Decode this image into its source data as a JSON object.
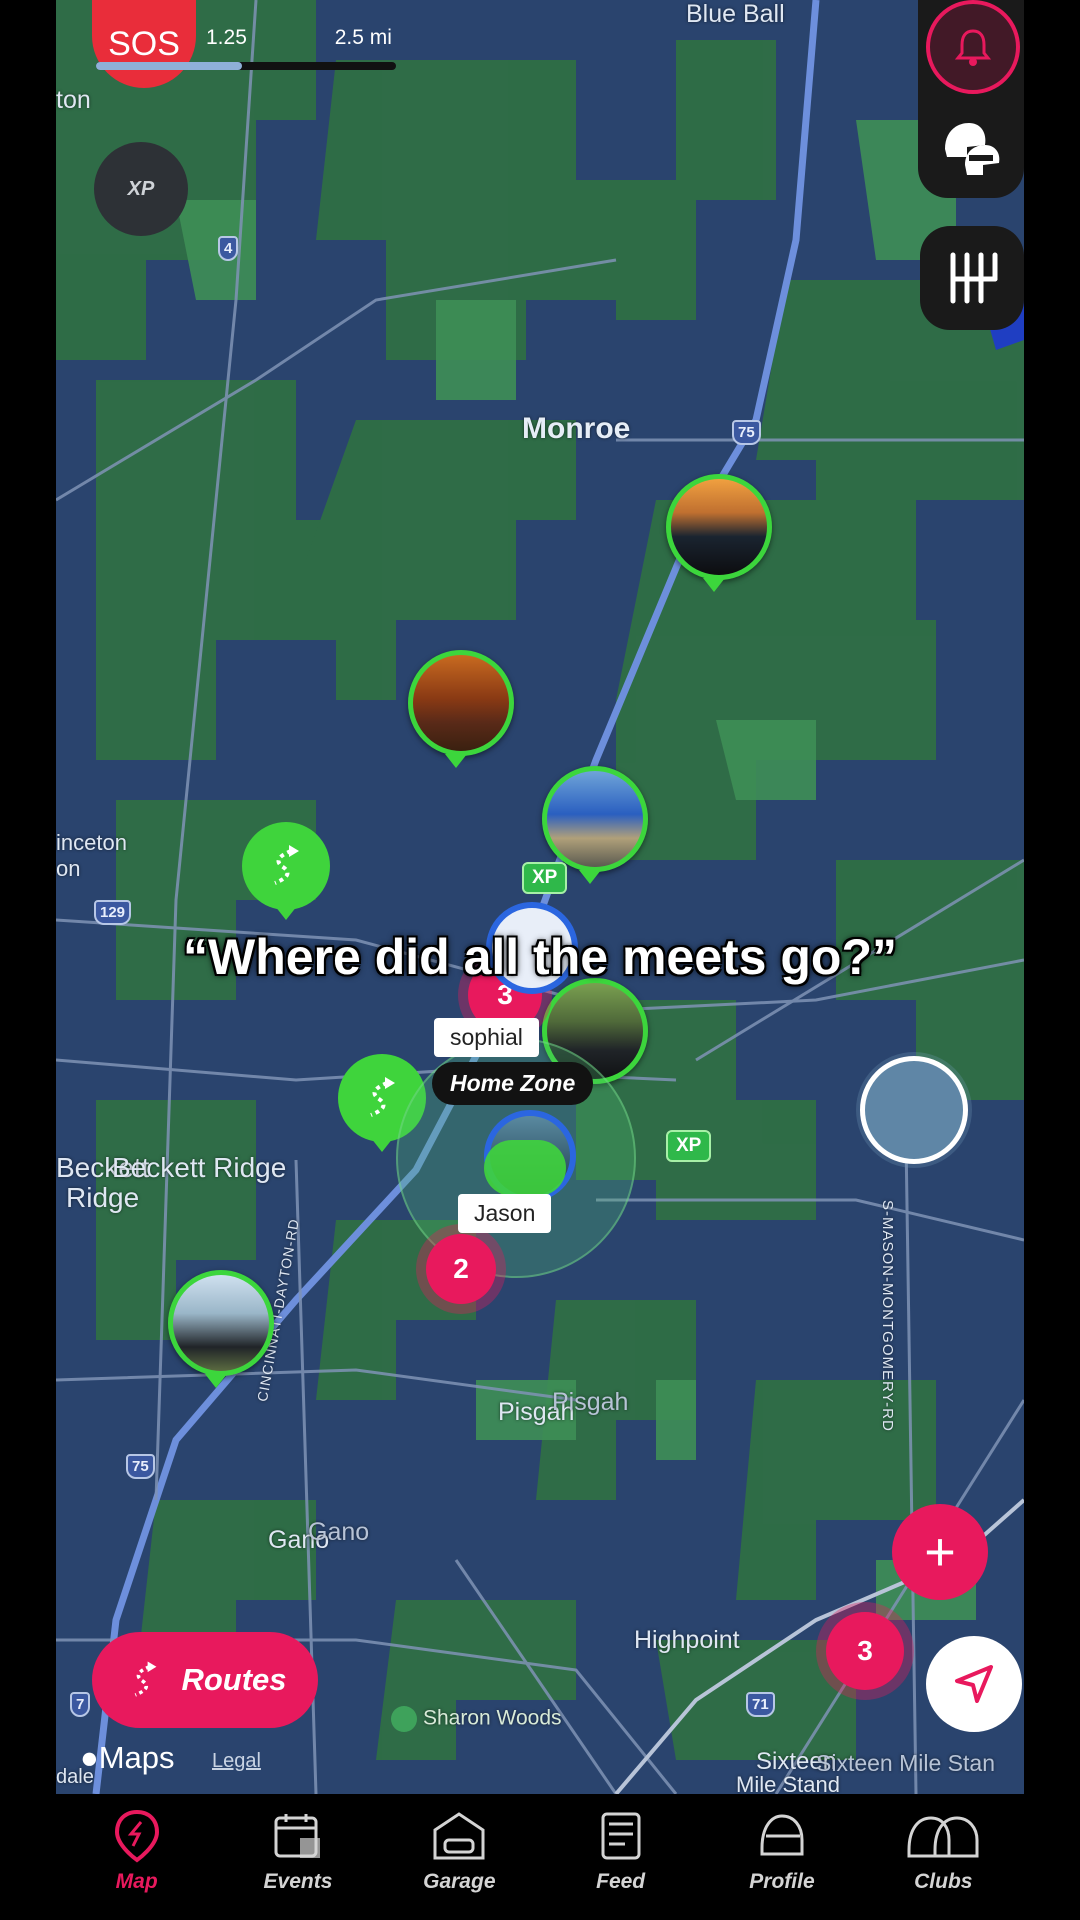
{
  "colors": {
    "accent": "#e8195d",
    "pin_green": "#3cd63c",
    "map_water": "#2a446e",
    "map_land": "#2f6d45"
  },
  "header": {
    "sos_label": "SOS",
    "scale_mid": "1.25",
    "scale_end": "2.5 mi",
    "xp_badge": "XP"
  },
  "map": {
    "labels": {
      "blue_ball": "Blue Ball",
      "ton": "ton",
      "monroe": "Monroe",
      "inceton": "inceton",
      "on": "on",
      "beckett1": "Beckett",
      "beckett_ridge": "Beckett Ridge",
      "ridge": "Ridge",
      "pisgah1": "Pisgah",
      "pisgah2": "Pisgah",
      "gano1": "Gano",
      "gano2": "Gano",
      "highpoint": "Highpoint",
      "sharon_woods": "Sharon Woods",
      "sixteen1": "Sixteen",
      "sixteen2": "Mile Stand",
      "sixteen3": "Sixteen Mile Stan",
      "dale": "dale",
      "mason_rd": "S-MASON-MONTGOMERY-RD",
      "cin_day": "CINCINNATI-DAYTON-RD"
    },
    "shields": {
      "s4": "4",
      "s75a": "75",
      "s129": "129",
      "s75b": "75",
      "s71": "71",
      "s7x": "7"
    },
    "xp_tags": [
      "XP",
      "XP"
    ],
    "clusters": [
      "3",
      "2",
      "3"
    ],
    "names": {
      "sophia": "sophial",
      "home_zone": "Home Zone",
      "jason": "Jason"
    },
    "routes_button": "Routes",
    "attribution": {
      "maps": "Maps",
      "legal": "Legal"
    }
  },
  "caption": "“Where did all the meets go?”",
  "tabs": [
    {
      "label": "Map",
      "icon": "map-pin-icon"
    },
    {
      "label": "Events",
      "icon": "calendar-icon"
    },
    {
      "label": "Garage",
      "icon": "garage-icon"
    },
    {
      "label": "Feed",
      "icon": "feed-icon"
    },
    {
      "label": "Profile",
      "icon": "helmet-icon"
    },
    {
      "label": "Clubs",
      "icon": "clubs-icon"
    }
  ]
}
